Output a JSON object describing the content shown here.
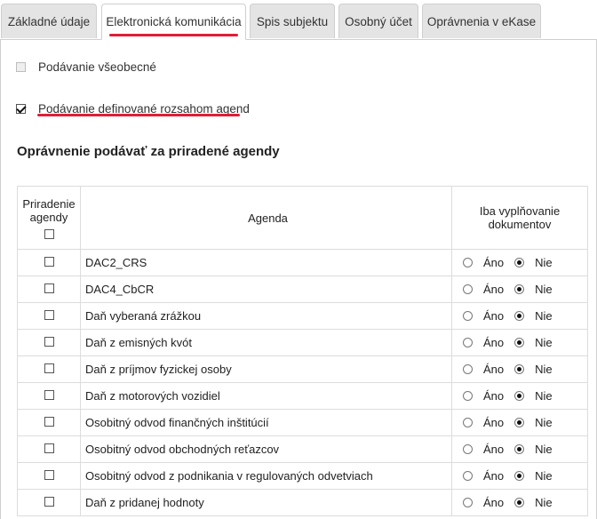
{
  "tabs": [
    {
      "label": "Základné údaje",
      "active": false
    },
    {
      "label": "Elektronická komunikácia",
      "active": true
    },
    {
      "label": "Spis subjektu",
      "active": false
    },
    {
      "label": "Osobný účet",
      "active": false
    },
    {
      "label": "Oprávnenia v eKase",
      "active": false
    }
  ],
  "options": {
    "general": {
      "label": "Podávanie všeobecné",
      "checked": false,
      "disabled": true
    },
    "defined": {
      "label": "Podávanie definované rozsahom agend",
      "checked": true
    }
  },
  "section_title": "Oprávnenie podávať za priradené agendy",
  "table": {
    "headers": {
      "assign_line1": "Priradenie",
      "assign_line2": "agendy",
      "agenda": "Agenda",
      "fill_line1": "Iba vyplňovanie",
      "fill_line2": "dokumentov"
    },
    "yes_label": "Áno",
    "no_label": "Nie",
    "rows": [
      {
        "agenda": "DAC2_CRS",
        "fill_only": "Nie"
      },
      {
        "agenda": "DAC4_CbCR",
        "fill_only": "Nie"
      },
      {
        "agenda": "Daň vyberaná zrážkou",
        "fill_only": "Nie"
      },
      {
        "agenda": "Daň z emisných kvót",
        "fill_only": "Nie"
      },
      {
        "agenda": "Daň z príjmov fyzickej osoby",
        "fill_only": "Nie"
      },
      {
        "agenda": "Daň z motorových vozidiel",
        "fill_only": "Nie"
      },
      {
        "agenda": "Osobitný odvod finančných inštitúcií",
        "fill_only": "Nie"
      },
      {
        "agenda": "Osobitný odvod obchodných reťazcov",
        "fill_only": "Nie"
      },
      {
        "agenda": "Osobitný odvod z podnikania v regulovaných odvetviach",
        "fill_only": "Nie"
      },
      {
        "agenda": "Daň z pridanej hodnoty",
        "fill_only": "Nie"
      }
    ]
  },
  "colors": {
    "accent_underline": "#e01e37",
    "tab_bg": "#e4e4e4"
  }
}
